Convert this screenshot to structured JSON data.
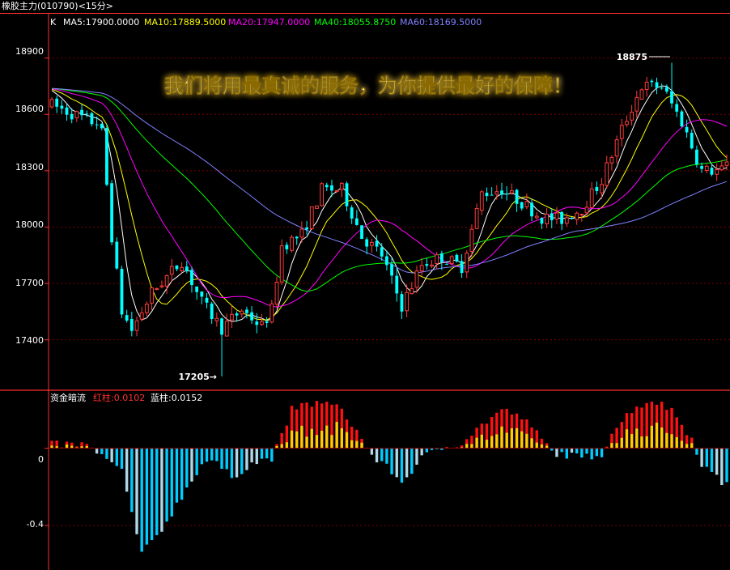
{
  "window": {
    "title": "橡胶主力(010790)<15分>"
  },
  "colors": {
    "up": "#ff3b3b",
    "down": "#00ffff",
    "grid": "#7a0000",
    "axis": "#ff3030",
    "ma5": "#ffffff",
    "ma10": "#ffff00",
    "ma20": "#ff00ff",
    "ma40": "#00ff00",
    "ma60": "#8080ff",
    "hist_red": "#ff1010",
    "hist_yellow": "#ffcc00",
    "hist_blue": "#00ccff",
    "hist_lightblue": "#b0d8e8"
  },
  "overlay_text": "我们将用最真诚的服务，为你提供最好的保障！",
  "chart_data": [
    {
      "type": "candlestick",
      "title": "K",
      "ma_legend": [
        {
          "label": "MA5:17900.0000",
          "color_key": "ma5"
        },
        {
          "label": "MA10:17889.5000",
          "color_key": "ma10"
        },
        {
          "label": "MA20:17947.0000",
          "color_key": "ma20"
        },
        {
          "label": "MA40:18055.8750",
          "color_key": "ma40"
        },
        {
          "label": "MA60:18169.5000",
          "color_key": "ma60"
        }
      ],
      "ylim": [
        17140,
        19140
      ],
      "yticks": [
        "17400",
        "17700",
        "18000",
        "18300",
        "18600",
        "18900"
      ],
      "max_label": "18875",
      "min_label": "17205→",
      "max_value": 18875,
      "min_value": 17205,
      "max_index": 124,
      "min_index": 34,
      "anchors": [
        [
          0,
          18650
        ],
        [
          8,
          18560
        ],
        [
          9,
          18560
        ],
        [
          10,
          18500
        ],
        [
          12,
          17950
        ],
        [
          14,
          17550
        ],
        [
          16,
          17450
        ],
        [
          20,
          17650
        ],
        [
          26,
          17820
        ],
        [
          30,
          17600
        ],
        [
          34,
          17460
        ],
        [
          38,
          17560
        ],
        [
          42,
          17470
        ],
        [
          44,
          17560
        ],
        [
          46,
          17900
        ],
        [
          50,
          17960
        ],
        [
          54,
          18200
        ],
        [
          58,
          18200
        ],
        [
          62,
          17950
        ],
        [
          66,
          17850
        ],
        [
          70,
          17580
        ],
        [
          74,
          17800
        ],
        [
          78,
          17840
        ],
        [
          82,
          17790
        ],
        [
          86,
          18180
        ],
        [
          90,
          18200
        ],
        [
          94,
          18130
        ],
        [
          98,
          18050
        ],
        [
          102,
          18040
        ],
        [
          106,
          18100
        ],
        [
          110,
          18250
        ],
        [
          114,
          18520
        ],
        [
          118,
          18750
        ],
        [
          122,
          18750
        ],
        [
          126,
          18560
        ],
        [
          130,
          18300
        ],
        [
          134,
          18300
        ],
        [
          135,
          18330
        ]
      ],
      "n": 136
    },
    {
      "type": "bar",
      "title": "资金暗流",
      "series": [
        {
          "name": "红柱",
          "value_label": "红柱:0.0102"
        },
        {
          "name": "蓝柱",
          "value_label": "蓝柱:0.0152"
        }
      ],
      "ylim": [
        -0.63,
        0.3
      ],
      "yticks": [
        "0",
        "-0.4"
      ],
      "anchors": [
        [
          0,
          0.02
        ],
        [
          6,
          0.02
        ],
        [
          8,
          0.0
        ],
        [
          10,
          -0.04
        ],
        [
          14,
          -0.12
        ],
        [
          18,
          -0.55
        ],
        [
          22,
          -0.42
        ],
        [
          26,
          -0.25
        ],
        [
          30,
          -0.08
        ],
        [
          32,
          -0.06
        ],
        [
          36,
          -0.15
        ],
        [
          40,
          -0.08
        ],
        [
          44,
          -0.05
        ],
        [
          46,
          0.06
        ],
        [
          48,
          0.2
        ],
        [
          50,
          0.22
        ],
        [
          54,
          0.24
        ],
        [
          58,
          0.2
        ],
        [
          62,
          0.05
        ],
        [
          64,
          -0.04
        ],
        [
          68,
          -0.12
        ],
        [
          70,
          -0.18
        ],
        [
          74,
          -0.05
        ],
        [
          78,
          0.0
        ],
        [
          82,
          0.03
        ],
        [
          86,
          0.12
        ],
        [
          90,
          0.2
        ],
        [
          94,
          0.16
        ],
        [
          98,
          0.05
        ],
        [
          100,
          -0.02
        ],
        [
          106,
          -0.05
        ],
        [
          110,
          -0.03
        ],
        [
          112,
          0.08
        ],
        [
          116,
          0.2
        ],
        [
          120,
          0.25
        ],
        [
          124,
          0.2
        ],
        [
          128,
          0.05
        ],
        [
          130,
          -0.08
        ],
        [
          134,
          -0.18
        ],
        [
          135,
          -0.17
        ]
      ]
    }
  ]
}
